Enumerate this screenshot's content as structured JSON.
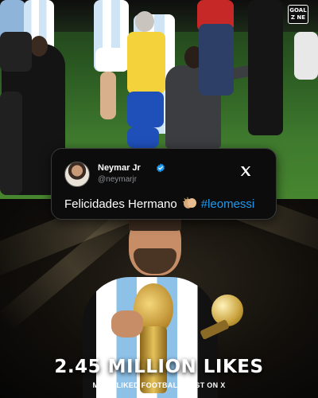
{
  "tweet": {
    "display_name": "Neymar Jr",
    "handle": "@neymarjr",
    "text": "Felicidades Hermano",
    "hashtag": "#leomessi",
    "emoji_icon": "clapping-hands-icon",
    "verified_color": "#1d9bf0"
  },
  "headline": {
    "title": "2.45 MILLION LIKES",
    "subtitle": "MOST LIKED FOOTBALL POST ON X"
  },
  "logo": {
    "line1": "GOAL",
    "line2": "Z NE"
  },
  "colors": {
    "hashtag": "#1d9bf0",
    "card_bg": "#0c0c0c",
    "text": "#ffffff"
  }
}
